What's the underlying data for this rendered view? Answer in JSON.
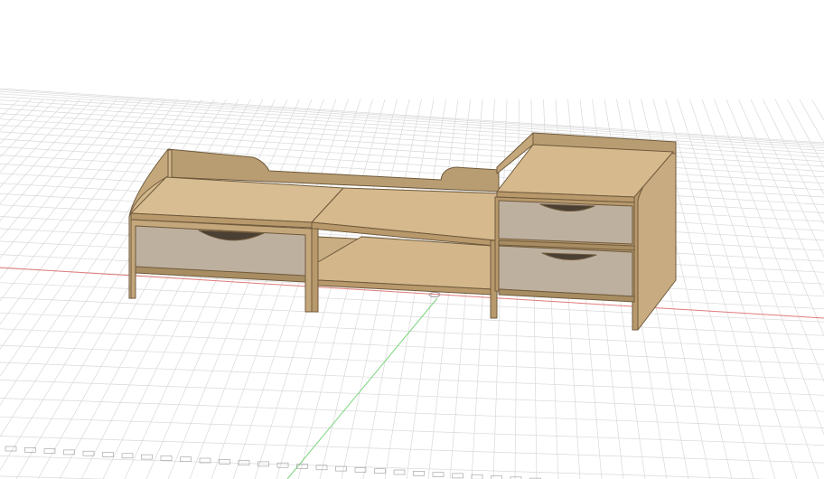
{
  "viewport": {
    "background": "#ffffff",
    "grid_color": "#d9d9d9",
    "grid_major_color": "#c4c4c4",
    "x_axis_color": "#e07b7b",
    "y_axis_color": "#7bd47b"
  },
  "model": {
    "material_color": "#c8a97e",
    "material_top_color": "#d6b98e",
    "material_edge_color": "#8a6f4a",
    "drawer_front_color": "#bfb2a0"
  }
}
